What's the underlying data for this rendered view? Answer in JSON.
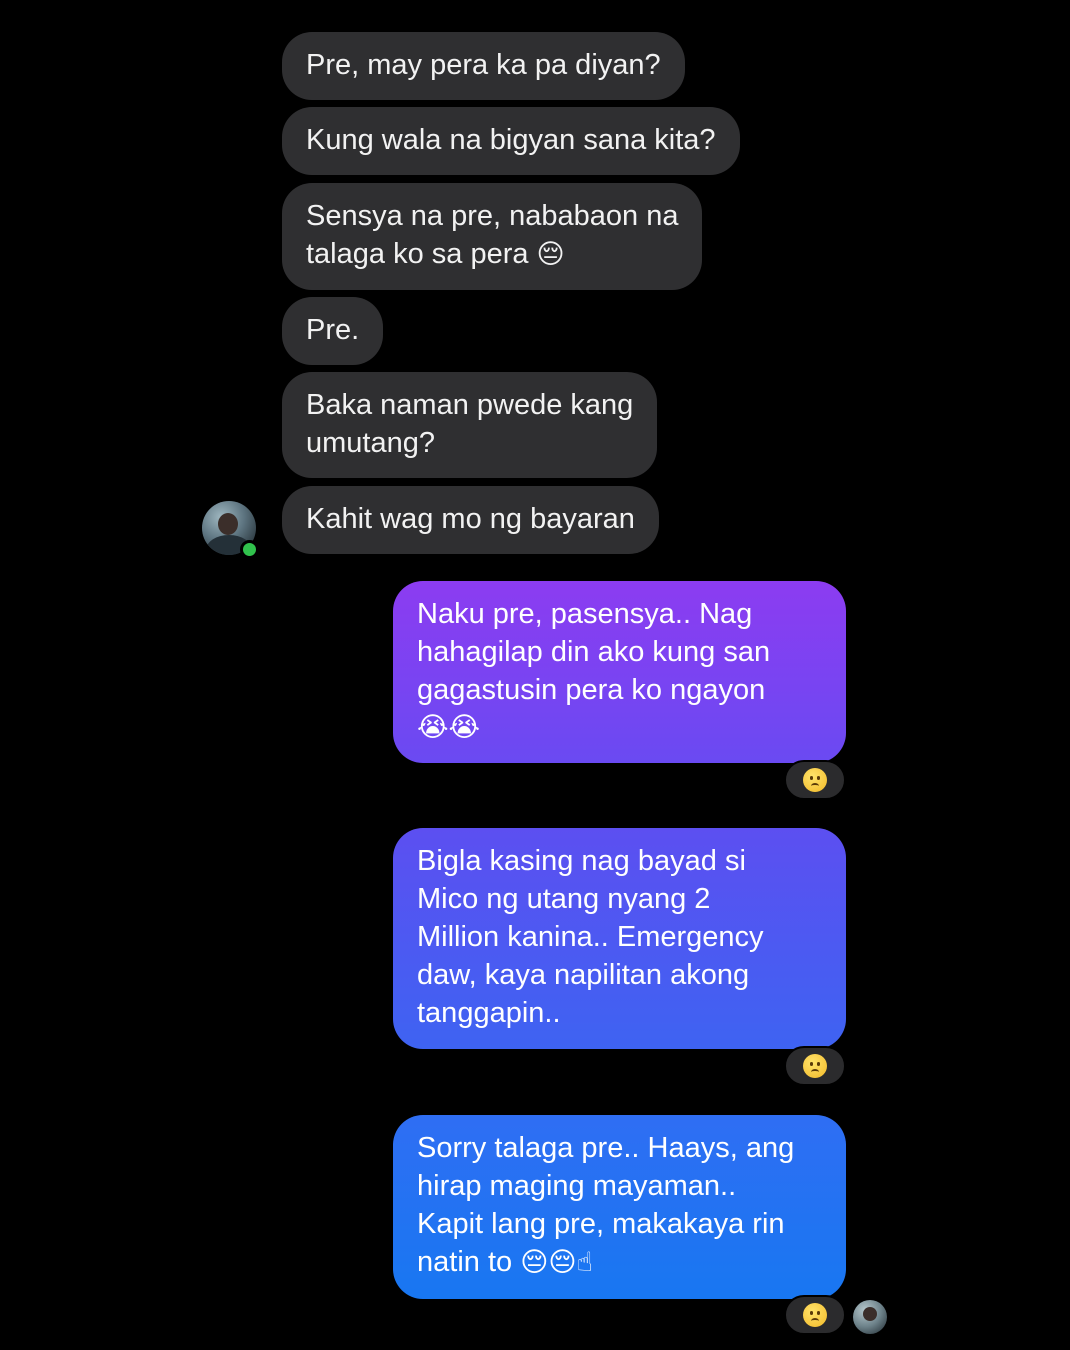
{
  "colors": {
    "background": "#000000",
    "incoming_bubble": "#2f2f31",
    "outgoing_gradient_top": "#8a3cf0",
    "outgoing_gradient_mid": "#4f58f0",
    "outgoing_gradient_bottom": "#1877f2",
    "online_indicator": "#31c24d"
  },
  "incoming": [
    {
      "text": "Pre, may pera ka pa diyan?"
    },
    {
      "text": "Kung wala na bigyan sana kita?"
    },
    {
      "line1": "Sensya na pre, nababaon na",
      "line2": "talaga ko sa pera",
      "emoji": "😔"
    },
    {
      "text": "Pre."
    },
    {
      "line1": "Baka naman pwede kang",
      "line2": "umutang?"
    },
    {
      "text": "Kahit wag mo ng bayaran"
    }
  ],
  "outgoing": [
    {
      "line1": "Naku pre, pasensya.. Nag",
      "line2": "hahagilap din ako kung san",
      "line3": "gagastusin pera ko ngayon",
      "emoji": "😭😭",
      "reaction": "sad-face-icon"
    },
    {
      "line1": "Bigla kasing nag bayad si",
      "line2": "Mico ng utang nyang 2",
      "line3": "Million kanina.. Emergency",
      "line4": "daw, kaya napilitan akong",
      "line5": "tanggapin..",
      "reaction": "sad-face-icon"
    },
    {
      "line1": "Sorry talaga pre.. Haays, ang",
      "line2": "hirap maging mayaman..",
      "line3": "Kapit lang pre, makakaya rin",
      "line4": "natin to",
      "emoji": "😔😔☝",
      "reaction": "sad-face-icon"
    }
  ]
}
